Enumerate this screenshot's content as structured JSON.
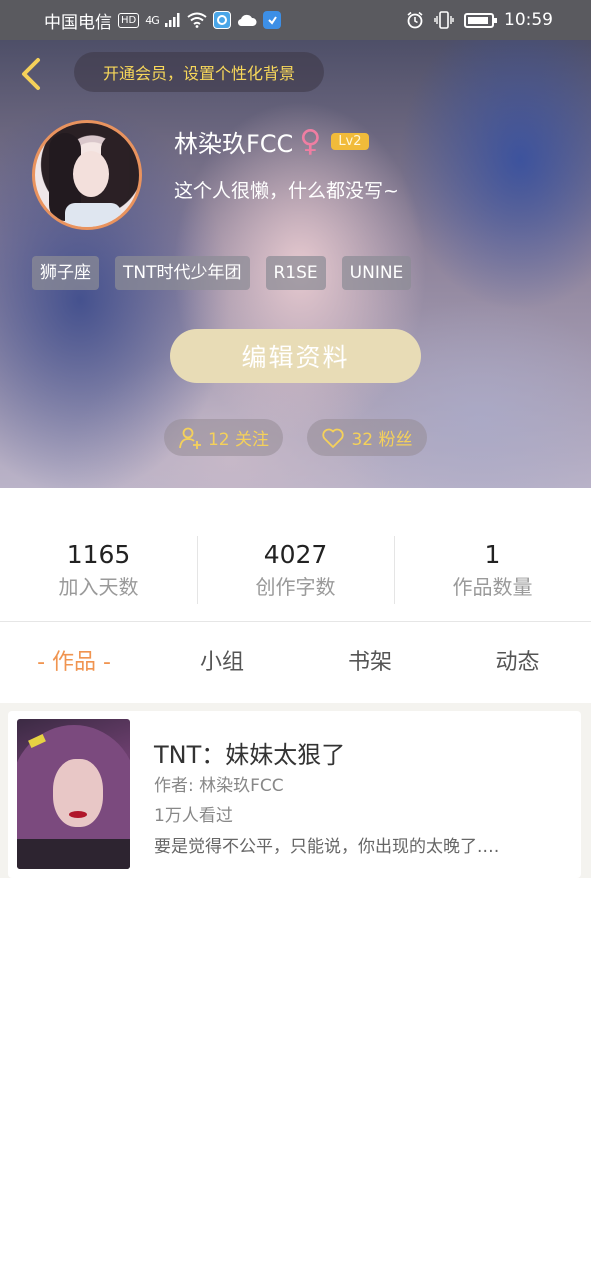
{
  "status_bar": {
    "carrier": "中国电信",
    "hd": "HD",
    "network": "4G",
    "time": "10:59"
  },
  "header": {
    "vip_banner": "开通会员，设置个性化背景",
    "username": "林染玖FCC",
    "gender_symbol": "♀",
    "level": "Lv2",
    "signature": "这个人很懒，什么都没写~",
    "tags": [
      "狮子座",
      "TNT时代少年团",
      "R1SE",
      "UNINE"
    ],
    "edit_button": "编辑资料",
    "following_label": "12 关注",
    "fans_label": "32 粉丝"
  },
  "stats": [
    {
      "value": "1165",
      "label": "加入天数"
    },
    {
      "value": "4027",
      "label": "创作字数"
    },
    {
      "value": "1",
      "label": "作品数量"
    }
  ],
  "tabs": {
    "works": "- 作品 -",
    "groups": "小组",
    "bookshelf": "书架",
    "activity": "动态",
    "active": "works"
  },
  "works": [
    {
      "title": "TNT：妹妹太狠了",
      "author": "作者: 林染玖FCC",
      "views": "1万人看过",
      "excerpt": "要是觉得不公平，只能说，你出现的太晚了.…"
    }
  ],
  "colors": {
    "accent": "#f09450",
    "gold": "#f5d15a",
    "edit_button_bg": "#e8dcb6",
    "level_badge": "#f1bb3a"
  }
}
